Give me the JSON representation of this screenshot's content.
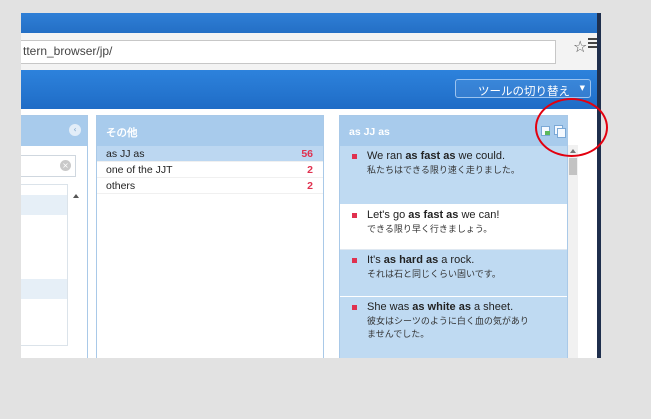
{
  "browser": {
    "url": "ttern_browser/jp/",
    "star_icon": "star-outline-icon",
    "menu_icon": "hamburger-menu-icon"
  },
  "toolbar": {
    "switch_label": "ツールの切り替え",
    "caret": "▼"
  },
  "left_panel": {
    "close_glyph": "‹",
    "clear_glyph": "×"
  },
  "middle_panel": {
    "title": "その他",
    "items": [
      {
        "label": "as JJ as",
        "count": "56",
        "selected": true
      },
      {
        "label": "one of the JJT",
        "count": "2",
        "selected": false
      },
      {
        "label": "others",
        "count": "2",
        "selected": false
      }
    ]
  },
  "right_panel": {
    "title": "as JJ as",
    "examples": [
      {
        "pre": "We ran ",
        "bold": "as fast as",
        "post": " we could.",
        "ja": "私たちはできる限り速く走りました。",
        "bg": "blue"
      },
      {
        "pre": "Let's go ",
        "bold": "as fast as",
        "post": " we can!",
        "ja": "できる限り早く行きましょう。",
        "bg": "white"
      },
      {
        "pre": "It's ",
        "bold": "as hard as",
        "post": " a rock.",
        "ja": "それは石と同じくらい固いです。",
        "bg": "blue"
      },
      {
        "pre": "She was ",
        "bold": "as white as",
        "post": " a sheet.",
        "ja": "彼女はシーツのように白く血の気がありませんでした。",
        "bg": "blue"
      }
    ]
  },
  "colors": {
    "toolbar_blue": "#1f6cc6",
    "panel_header": "#a8cbec",
    "selected_row": "#bcd7f1",
    "count_red": "#e0314f",
    "highlight_circle": "#e3000f"
  }
}
